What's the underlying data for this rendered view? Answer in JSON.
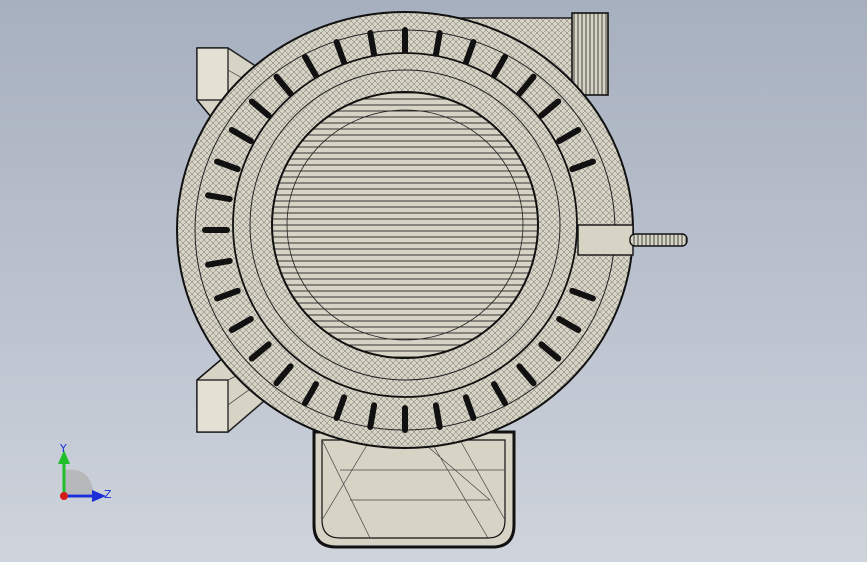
{
  "viewport": {
    "background_top": "#a7b0bf",
    "background_bottom": "#cfd4dc",
    "model_fill": "#d7d4c6",
    "model_edge": "#1a1a1a"
  },
  "triad": {
    "y_label": "Y",
    "z_label": "Z",
    "y_color": "#1fbf2a",
    "z_color": "#1c2fd6",
    "x_color": "#d41c1c"
  }
}
